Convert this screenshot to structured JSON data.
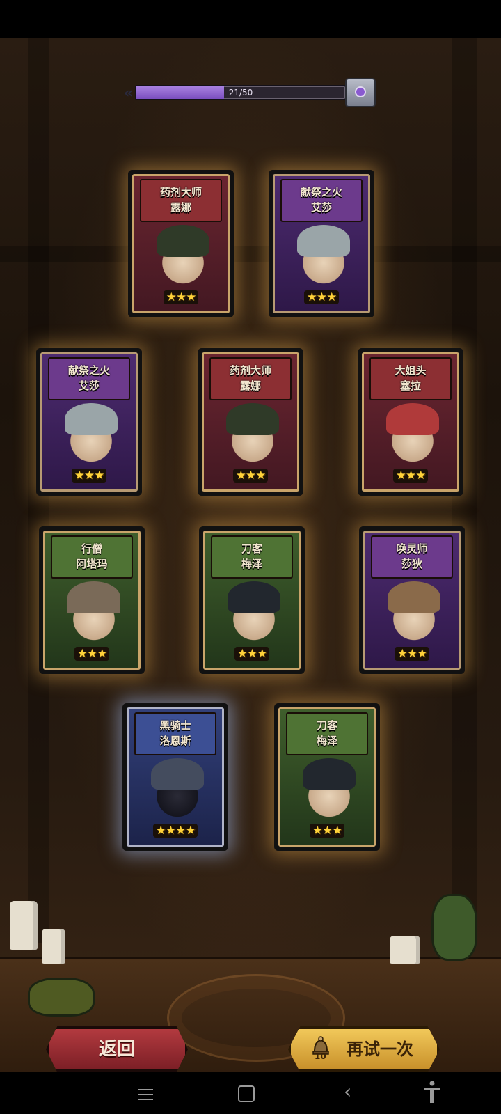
{
  "progress": {
    "text": "21/50",
    "value": 21,
    "max": 50,
    "fill_color": "#8b5fd0"
  },
  "cards": [
    {
      "title": "药剂大师",
      "name": "露娜",
      "stars": "★★★",
      "theme": "red"
    },
    {
      "title": "献祭之火",
      "name": "艾莎",
      "stars": "★★★",
      "theme": "purple"
    },
    {
      "title": "献祭之火",
      "name": "艾莎",
      "stars": "★★★",
      "theme": "purple"
    },
    {
      "title": "药剂大师",
      "name": "露娜",
      "stars": "★★★",
      "theme": "red"
    },
    {
      "title": "大姐头",
      "name": "塞拉",
      "stars": "★★★",
      "theme": "red"
    },
    {
      "title": "行僧",
      "name": "阿塔玛",
      "stars": "★★★",
      "theme": "green"
    },
    {
      "title": "刀客",
      "name": "梅泽",
      "stars": "★★★",
      "theme": "green"
    },
    {
      "title": "唤灵师",
      "name": "莎狄",
      "stars": "★★★",
      "theme": "purple"
    },
    {
      "title": "黑骑士",
      "name": "洛恩斯",
      "stars": "★★★★",
      "theme": "blue"
    },
    {
      "title": "刀客",
      "name": "梅泽",
      "stars": "★★★",
      "theme": "green"
    }
  ],
  "buttons": {
    "back_label": "返回",
    "retry_label": "再试一次",
    "retry_count": "10"
  },
  "icons": {
    "chest": "reward-chest-icon",
    "retry_cost": "summon-bell-icon",
    "nav_menu": "menu-icon",
    "nav_home": "home-icon",
    "nav_back": "back-icon",
    "nav_accessibility": "accessibility-icon"
  }
}
